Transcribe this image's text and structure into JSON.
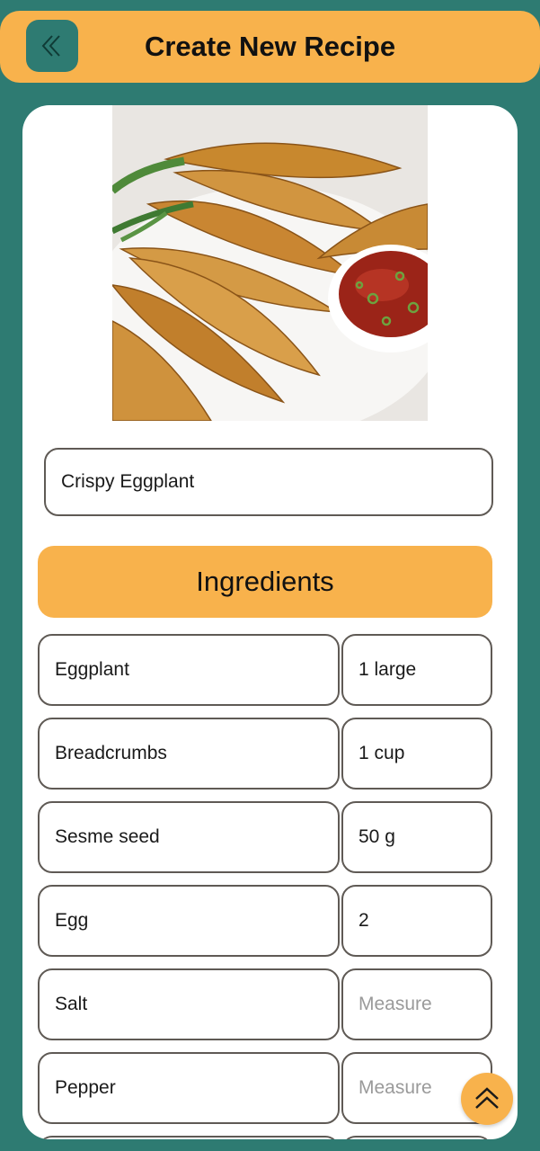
{
  "header": {
    "title": "Create New Recipe",
    "back_icon": "double-chevron-left-icon"
  },
  "recipe": {
    "name": "Crispy Eggplant"
  },
  "ingredients_section": {
    "label": "Ingredients"
  },
  "ingredients": [
    {
      "name": "Eggplant",
      "measure": "1 large",
      "measure_is_placeholder": false
    },
    {
      "name": "Breadcrumbs",
      "measure": "1 cup",
      "measure_is_placeholder": false
    },
    {
      "name": "Sesme seed",
      "measure": "50 g",
      "measure_is_placeholder": false
    },
    {
      "name": "Egg",
      "measure": "2",
      "measure_is_placeholder": false
    },
    {
      "name": "Salt",
      "measure": "Measure",
      "measure_is_placeholder": true
    },
    {
      "name": "Pepper",
      "measure": "Measure",
      "measure_is_placeholder": true
    }
  ],
  "scroll_top_icon": "double-chevron-up-icon",
  "colors": {
    "background": "#2e7b72",
    "accent": "#f8b24c",
    "field_border": "#5f5a55",
    "placeholder": "#9a9a9a"
  }
}
